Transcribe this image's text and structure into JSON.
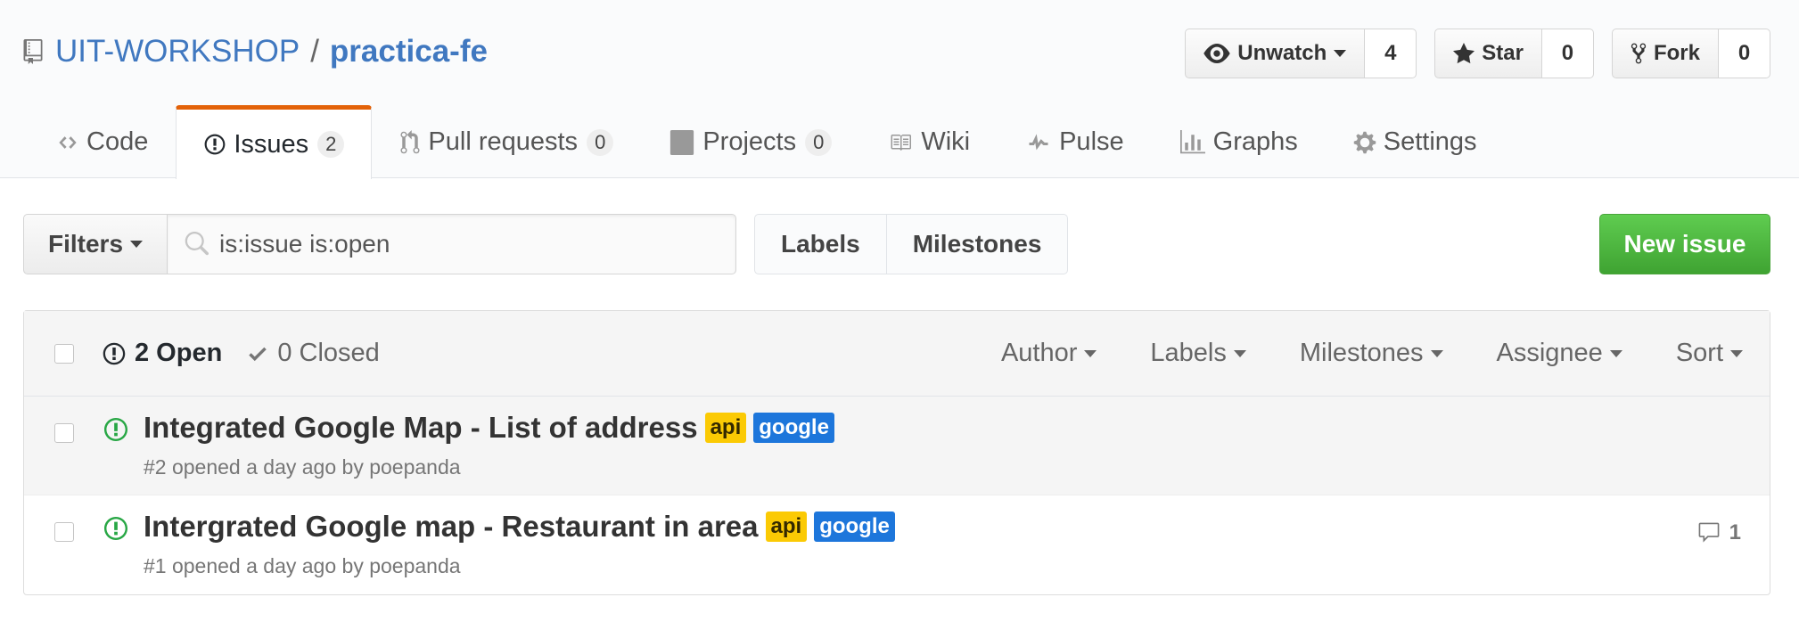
{
  "repo": {
    "owner": "UIT-WORKSHOP",
    "separator": "/",
    "name": "practica-fe"
  },
  "actions": {
    "watch": {
      "label": "Unwatch",
      "count": "4"
    },
    "star": {
      "label": "Star",
      "count": "0"
    },
    "fork": {
      "label": "Fork",
      "count": "0"
    }
  },
  "nav": [
    {
      "label": "Code",
      "icon": "code-icon"
    },
    {
      "label": "Issues",
      "icon": "issue-opened-icon",
      "counter": "2",
      "selected": true
    },
    {
      "label": "Pull requests",
      "icon": "git-pull-request-icon",
      "counter": "0"
    },
    {
      "label": "Projects",
      "icon": "project-icon",
      "counter": "0"
    },
    {
      "label": "Wiki",
      "icon": "book-icon"
    },
    {
      "label": "Pulse",
      "icon": "pulse-icon"
    },
    {
      "label": "Graphs",
      "icon": "graph-icon"
    },
    {
      "label": "Settings",
      "icon": "gear-icon"
    }
  ],
  "subnav": {
    "filters_label": "Filters",
    "search_value": "is:issue is:open",
    "labels_label": "Labels",
    "milestones_label": "Milestones",
    "new_issue_label": "New issue"
  },
  "issues_header": {
    "open_label": "2 Open",
    "closed_label": "0 Closed",
    "sorts": [
      "Author",
      "Labels",
      "Milestones",
      "Assignee",
      "Sort"
    ]
  },
  "issues": [
    {
      "title": "Integrated Google Map - List of address",
      "labels": [
        "api",
        "google"
      ],
      "meta": "#2 opened a day ago by poepanda",
      "comments": ""
    },
    {
      "title": "Intergrated Google map - Restaurant in area",
      "labels": [
        "api",
        "google"
      ],
      "meta": "#1 opened a day ago by poepanda",
      "comments": "1"
    }
  ],
  "colors": {
    "link": "#4078c0",
    "tab_accent": "#e36209",
    "open_green": "#28a745",
    "new_issue_green": "#4fba41",
    "label_api": "#fbca04",
    "label_google": "#1d76db"
  }
}
